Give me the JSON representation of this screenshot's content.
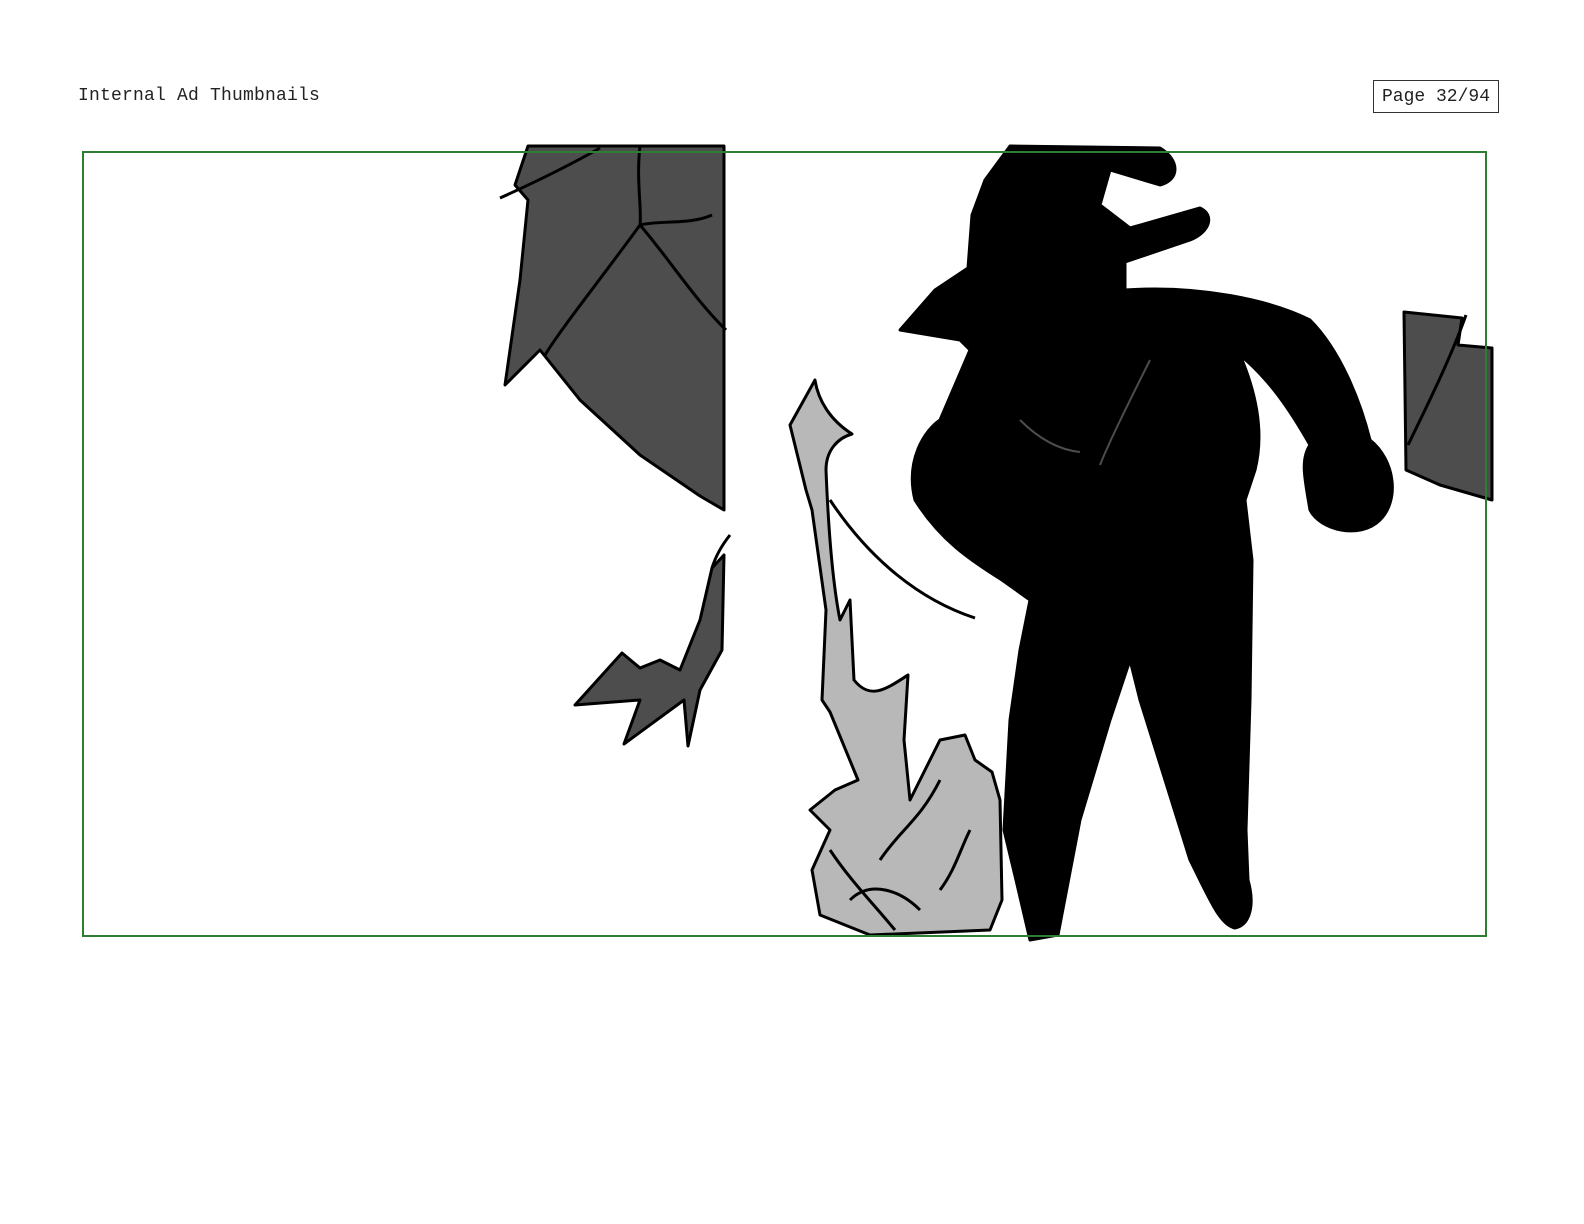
{
  "header": {
    "title": "Internal Ad Thumbnails",
    "page_indicator": "Page 32/94"
  },
  "panel": {
    "frame_color": "#2e7d32",
    "content": [
      "dark-grey-foliage-top",
      "small-dark-plant",
      "grey-flame-sprout",
      "black-silhouette-figure-with-hat",
      "dark-grey-foliage-right"
    ]
  },
  "colors": {
    "silhouette": "#000000",
    "dark_grey": "#4d4d4d",
    "light_grey": "#b8b8b8"
  }
}
